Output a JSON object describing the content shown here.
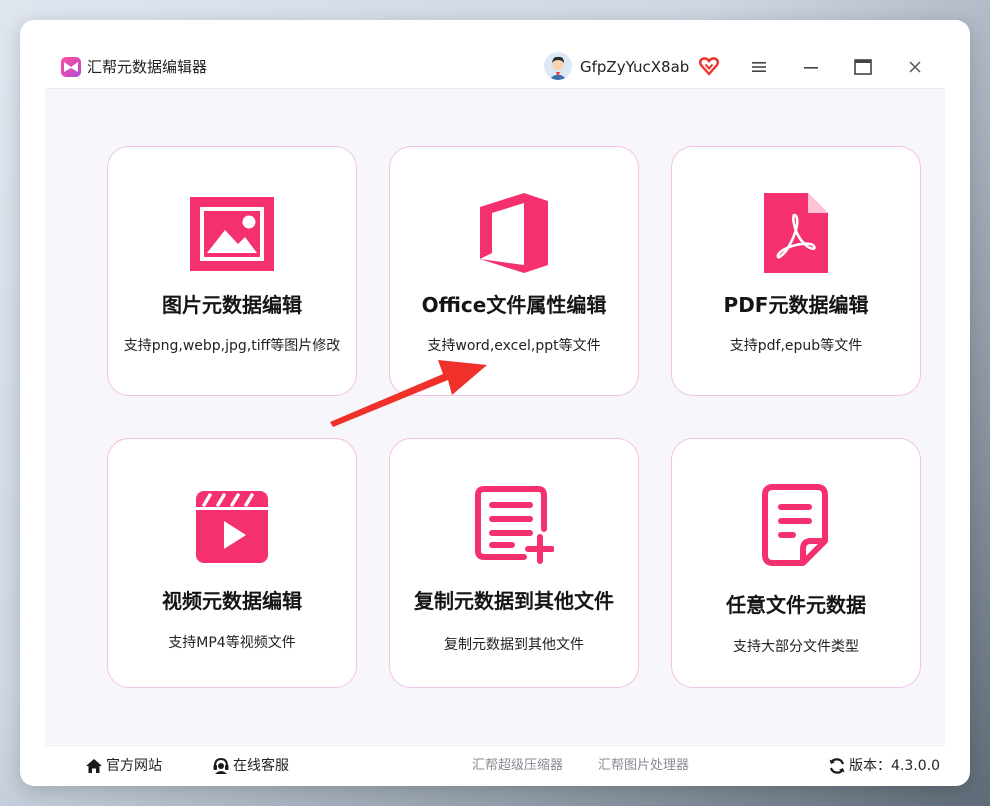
{
  "window": {
    "app_title": "汇帮元数据编辑器",
    "username": "GfpZyYucX8ab",
    "icons": {
      "logo": "app-logo-icon",
      "vip": "vip-heart-icon",
      "menu": "hamburger-menu-icon",
      "minimize": "minimize-icon",
      "maximize": "maximize-icon",
      "close": "close-icon"
    }
  },
  "cards": [
    {
      "title": "图片元数据编辑",
      "desc": "支持png,webp,jpg,tiff等图片修改",
      "icon": "image-icon"
    },
    {
      "title": "Office文件属性编辑",
      "desc": "支持word,excel,ppt等文件",
      "icon": "office-icon"
    },
    {
      "title": "PDF元数据编辑",
      "desc": "支持pdf,epub等文件",
      "icon": "pdf-icon"
    },
    {
      "title": "视频元数据编辑",
      "desc": "支持MP4等视频文件",
      "icon": "video-clapper-icon"
    },
    {
      "title": "复制元数据到其他文件",
      "desc": "复制元数据到其他文件",
      "icon": "copy-list-icon"
    },
    {
      "title": "任意文件元数据",
      "desc": "支持大部分文件类型",
      "icon": "document-icon"
    }
  ],
  "footer": {
    "official_site": "官方网站",
    "online_service": "在线客服",
    "compressor": "汇帮超级压缩器",
    "image_processor": "汇帮图片处理器",
    "version_label": "版本：4.3.0.0"
  },
  "colors": {
    "accent": "#f5306f",
    "card_border": "#f2c2e2",
    "arrow": "#f0302a"
  }
}
